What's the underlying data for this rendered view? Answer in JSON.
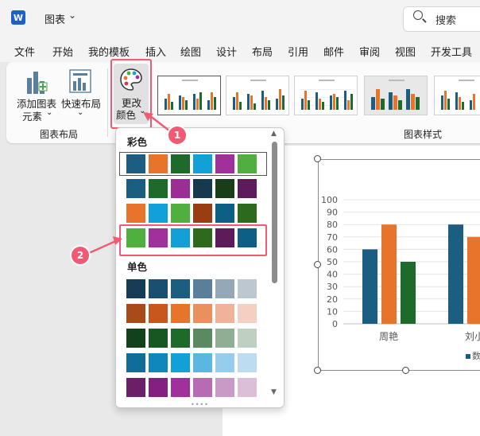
{
  "app": {
    "icon_label": "W",
    "doc_title": "图表"
  },
  "search": {
    "placeholder": "搜索"
  },
  "menu_tabs": [
    "文件",
    "开始",
    "我的模板",
    "插入",
    "绘图",
    "设计",
    "布局",
    "引用",
    "邮件",
    "审阅",
    "视图",
    "开发工具"
  ],
  "ribbon": {
    "add_element": {
      "line1": "添加图表",
      "line2": "元素"
    },
    "quick_layout": {
      "line1": "快速布局"
    },
    "change_color": {
      "line1": "更改",
      "line2": "颜色"
    },
    "group_layout": "图表布局",
    "group_styles": "图表样式"
  },
  "color_menu": {
    "colorful_label": "彩色",
    "mono_label": "单色",
    "colorful_rows": [
      [
        "#1c5d82",
        "#e8742c",
        "#1d6a2a",
        "#11a1d8",
        "#a12f9c",
        "#4fb03e"
      ],
      [
        "#1c5d82",
        "#1d6a2a",
        "#9a2e96",
        "#153a50",
        "#173e18",
        "#5e1b5c"
      ],
      [
        "#e8742c",
        "#11a1d8",
        "#4fb03e",
        "#9a3e12",
        "#0d5f86",
        "#2e6a1e"
      ],
      [
        "#4fb03e",
        "#a12f9c",
        "#11a1d8",
        "#2e6a1e",
        "#5e1b5c",
        "#0d5f86"
      ]
    ],
    "mono_rows": [
      [
        "#163c58",
        "#1b4f72",
        "#1c5d82",
        "#5b7e9a",
        "#94a8b8",
        "#bcc7d0"
      ],
      [
        "#a84a1a",
        "#c8571e",
        "#e8742c",
        "#ea8f5e",
        "#f0b39a",
        "#f4cfc2"
      ],
      [
        "#12421b",
        "#185622",
        "#1d6a2a",
        "#5b8a62",
        "#8fae94",
        "#bfd0c2"
      ],
      [
        "#0f6d9a",
        "#0f87bd",
        "#11a1d8",
        "#5bb6e2",
        "#96cdee",
        "#bddcf2"
      ],
      [
        "#6a1f66",
        "#851f80",
        "#a12f9c",
        "#b76bb2",
        "#c99ac6",
        "#dbbfd9"
      ]
    ]
  },
  "callouts": {
    "first": "1",
    "second": "2"
  },
  "chart_data": {
    "type": "bar",
    "categories": [
      "周艳",
      "刘小"
    ],
    "series": [
      {
        "values": [
          60,
          80
        ],
        "color": "#1c5d82"
      },
      {
        "values": [
          80,
          70
        ],
        "color": "#e8742c"
      },
      {
        "values": [
          50,
          null
        ],
        "color": "#1d6a2a"
      }
    ],
    "ylim": [
      0,
      100
    ],
    "yticks": [
      "100",
      "90",
      "80",
      "70",
      "60",
      "50",
      "40",
      "30",
      "20",
      "10",
      "0"
    ],
    "legend_text": "数",
    "legend_color": "#1c5d82",
    "grid": true
  }
}
